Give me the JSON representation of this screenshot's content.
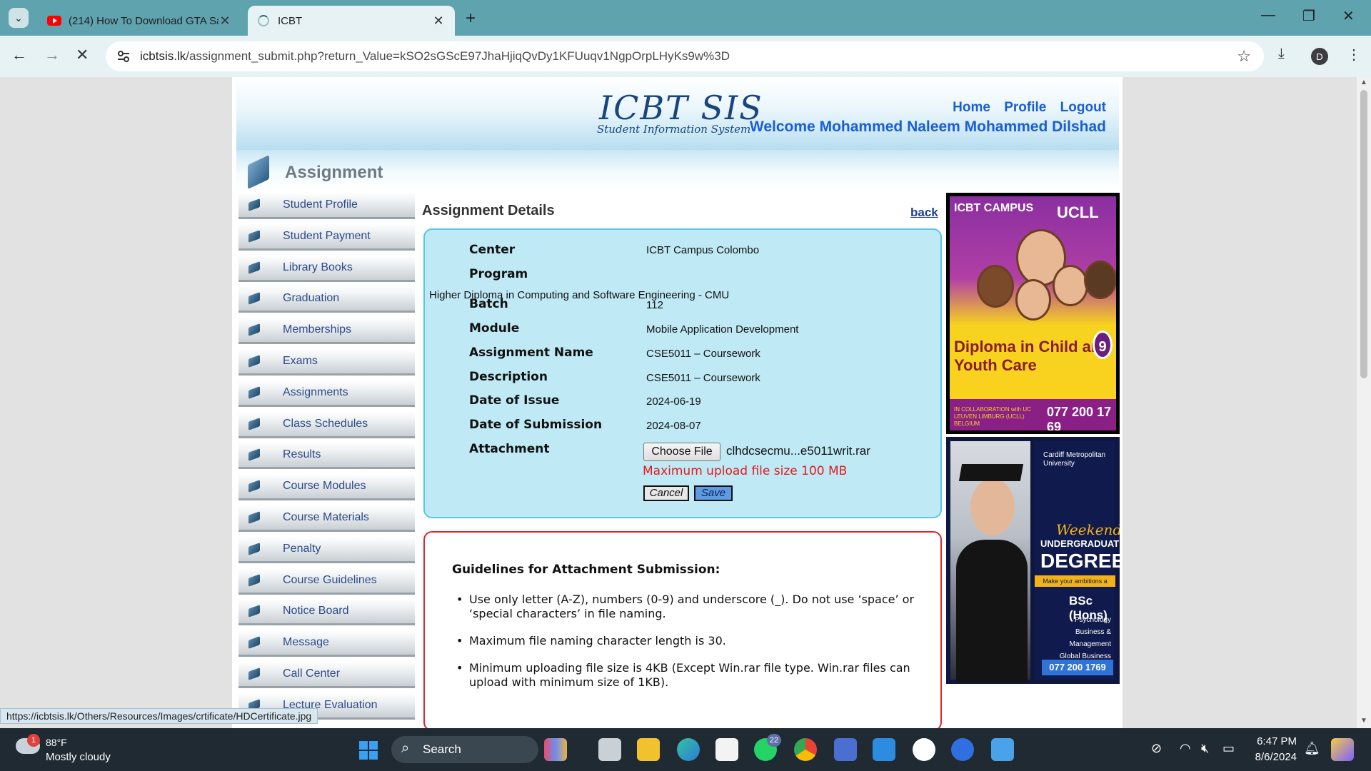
{
  "browser": {
    "tabs": [
      {
        "title": "(214) How To Download GTA Sa",
        "active": false
      },
      {
        "title": "ICBT",
        "active": true
      }
    ],
    "url_host": "icbtsis.lk",
    "url_path": "/assignment_submit.php?return_Value=kSO2sGScE97JhaHjiqQvDy1KFUuqv1NgpOrpLHyKs9w%3D",
    "profile_initial": "D",
    "status_url": "https://icbtsis.lk/Others/Resources/Images/crtificate/HDCertificate.jpg"
  },
  "header": {
    "logo_title": "ICBT SIS",
    "logo_subtitle": "Student Information System",
    "links": {
      "home": "Home",
      "profile": "Profile",
      "logout": "Logout"
    },
    "welcome": "Welcome Mohammed Naleem Mohammed Dilshad",
    "section_title": "Assignment"
  },
  "sidebar": {
    "items": [
      {
        "label": "Student Profile"
      },
      {
        "label": "Student Payment"
      },
      {
        "label": "Library Books"
      },
      {
        "label": "Graduation"
      },
      {
        "label": "Memberships"
      },
      {
        "label": "Exams"
      },
      {
        "label": "Assignments"
      },
      {
        "label": "Class Schedules"
      },
      {
        "label": "Results"
      },
      {
        "label": "Course Modules"
      },
      {
        "label": "Course Materials"
      },
      {
        "label": "Penalty"
      },
      {
        "label": "Course Guidelines"
      },
      {
        "label": "Notice Board"
      },
      {
        "label": "Message"
      },
      {
        "label": "Call Center"
      },
      {
        "label": "Lecture Evaluation"
      }
    ]
  },
  "main": {
    "heading": "Assignment Details",
    "back_label": "back",
    "fields": {
      "center_label": "Center",
      "center_value": "ICBT Campus Colombo",
      "program_label": "Program",
      "program_value": "Higher Diploma in Computing and Software Engineering - CMU",
      "batch_label": "Batch",
      "batch_value": "112",
      "module_label": "Module",
      "module_value": "Mobile Application Development",
      "assignment_label": "Assignment Name",
      "assignment_value": "CSE5011 – Coursework",
      "description_label": "Description",
      "description_value": "CSE5011 – Coursework",
      "issue_label": "Date of Issue",
      "issue_value": "2024-06-19",
      "submission_label": "Date of Submission",
      "submission_value": "2024-08-07",
      "attachment_label": "Attachment"
    },
    "choose_file_label": "Choose File",
    "file_name": "clhdcsecmu...e5011writ.rar",
    "upload_note": "Maximum upload file size 100 MB",
    "cancel_label": "Cancel",
    "save_label": "Save",
    "guidelines": {
      "title": "Guidelines for Attachment Submission:",
      "items": [
        "Use only letter (A-Z), numbers (0-9) and underscore (_). Do not use ‘space’ or ‘special characters’ in file naming.",
        "Maximum file naming character length is 30.",
        "Minimum uploading file size is 4KB (Except Win.rar file type. Win.rar files can upload with minimum size of 1KB)."
      ]
    }
  },
  "ads": {
    "ad1": {
      "brand_left": "ICBT CAMPUS",
      "brand_right": "UCLL",
      "title": "Diploma in Child and Youth Care",
      "badge": "9",
      "collab": "IN COLLABORATION with UC LEUVEN LIMBURG (UCLL) BELGIUM",
      "phone": "077 200 17 69"
    },
    "ad2": {
      "university": "Cardiff Metropolitan University",
      "weekend": "Weekend",
      "undergraduate": "UNDERGRADUATE",
      "degrees": "DEGREES",
      "tagline": "Make your ambitions a reality",
      "bsc": "BSc (Hons)",
      "courses": [
        "Psychology",
        "Business & Management",
        "Global Business Management"
      ],
      "phone": "077 200 1769"
    }
  },
  "taskbar": {
    "weather_temp": "88°F",
    "weather_desc": "Mostly cloudy",
    "weather_badge": "1",
    "search_label": "Search",
    "whatsapp_badge": "22",
    "time": "6:47 PM",
    "date": "8/6/2024"
  }
}
